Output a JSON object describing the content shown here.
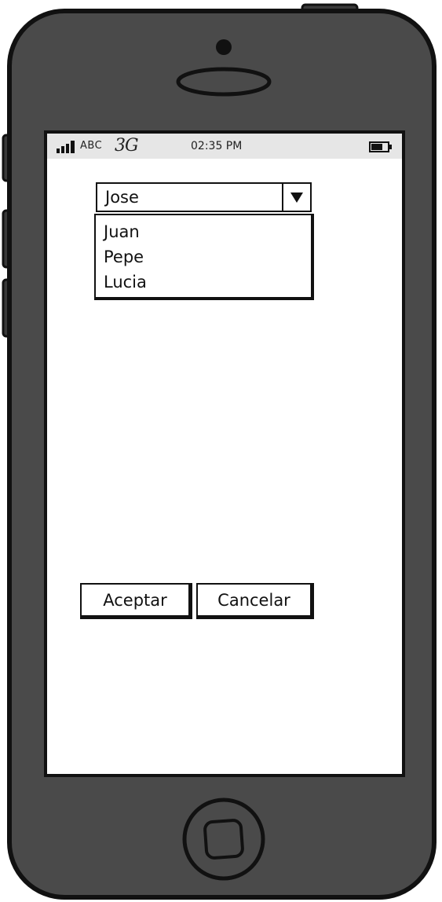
{
  "statusbar": {
    "carrier": "ABC",
    "network": "3G",
    "time": "02:35 PM",
    "signal_icon": "signal-bars-icon",
    "battery_icon": "battery-icon"
  },
  "select": {
    "value": "Jose",
    "arrow_icon": "dropdown-arrow-icon",
    "options": [
      "Juan",
      "Pepe",
      "Lucia"
    ]
  },
  "buttons": {
    "accept_label": "Aceptar",
    "cancel_label": "Cancelar"
  },
  "device": {
    "home_icon": "home-button-icon",
    "camera_icon": "front-camera-icon",
    "speaker_icon": "earpiece-speaker-icon"
  },
  "colors": {
    "phone_body": "#4a4a4a",
    "outline": "#111111",
    "statusbar_bg": "#e6e6e6",
    "screen_bg": "#ffffff"
  }
}
